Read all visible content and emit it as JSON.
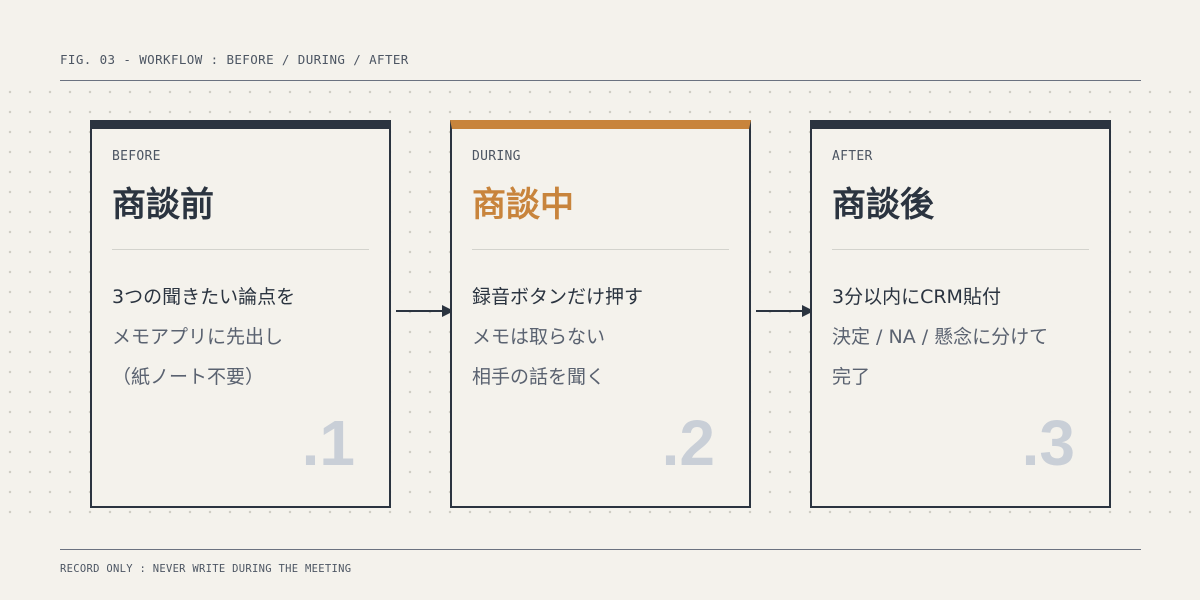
{
  "header": {
    "caption": "FIG. 03 - WORKFLOW : BEFORE / DURING / AFTER"
  },
  "stages": [
    {
      "label": "BEFORE",
      "title": "商談前",
      "lines": [
        "3つの聞きたい論点を",
        "メモアプリに先出し",
        "（紙ノート不要）"
      ],
      "number": ".1"
    },
    {
      "label": "DURING",
      "title": "商談中",
      "lines": [
        "録音ボタンだけ押す",
        "メモは取らない",
        "相手の話を聞く"
      ],
      "number": ".2"
    },
    {
      "label": "AFTER",
      "title": "商談後",
      "lines": [
        "3分以内にCRM貼付",
        "決定 / NA / 懸念に分けて",
        "完了"
      ],
      "number": ".3"
    }
  ],
  "footer": {
    "note": "RECORD ONLY : NEVER WRITE DURING THE MEETING"
  },
  "colors": {
    "ink": "#2b3440",
    "accent": "#c8843c",
    "muted_number": "#c9cfd7",
    "background": "#f4f2ec"
  },
  "icons": {
    "connector": "arrow-right-icon"
  }
}
